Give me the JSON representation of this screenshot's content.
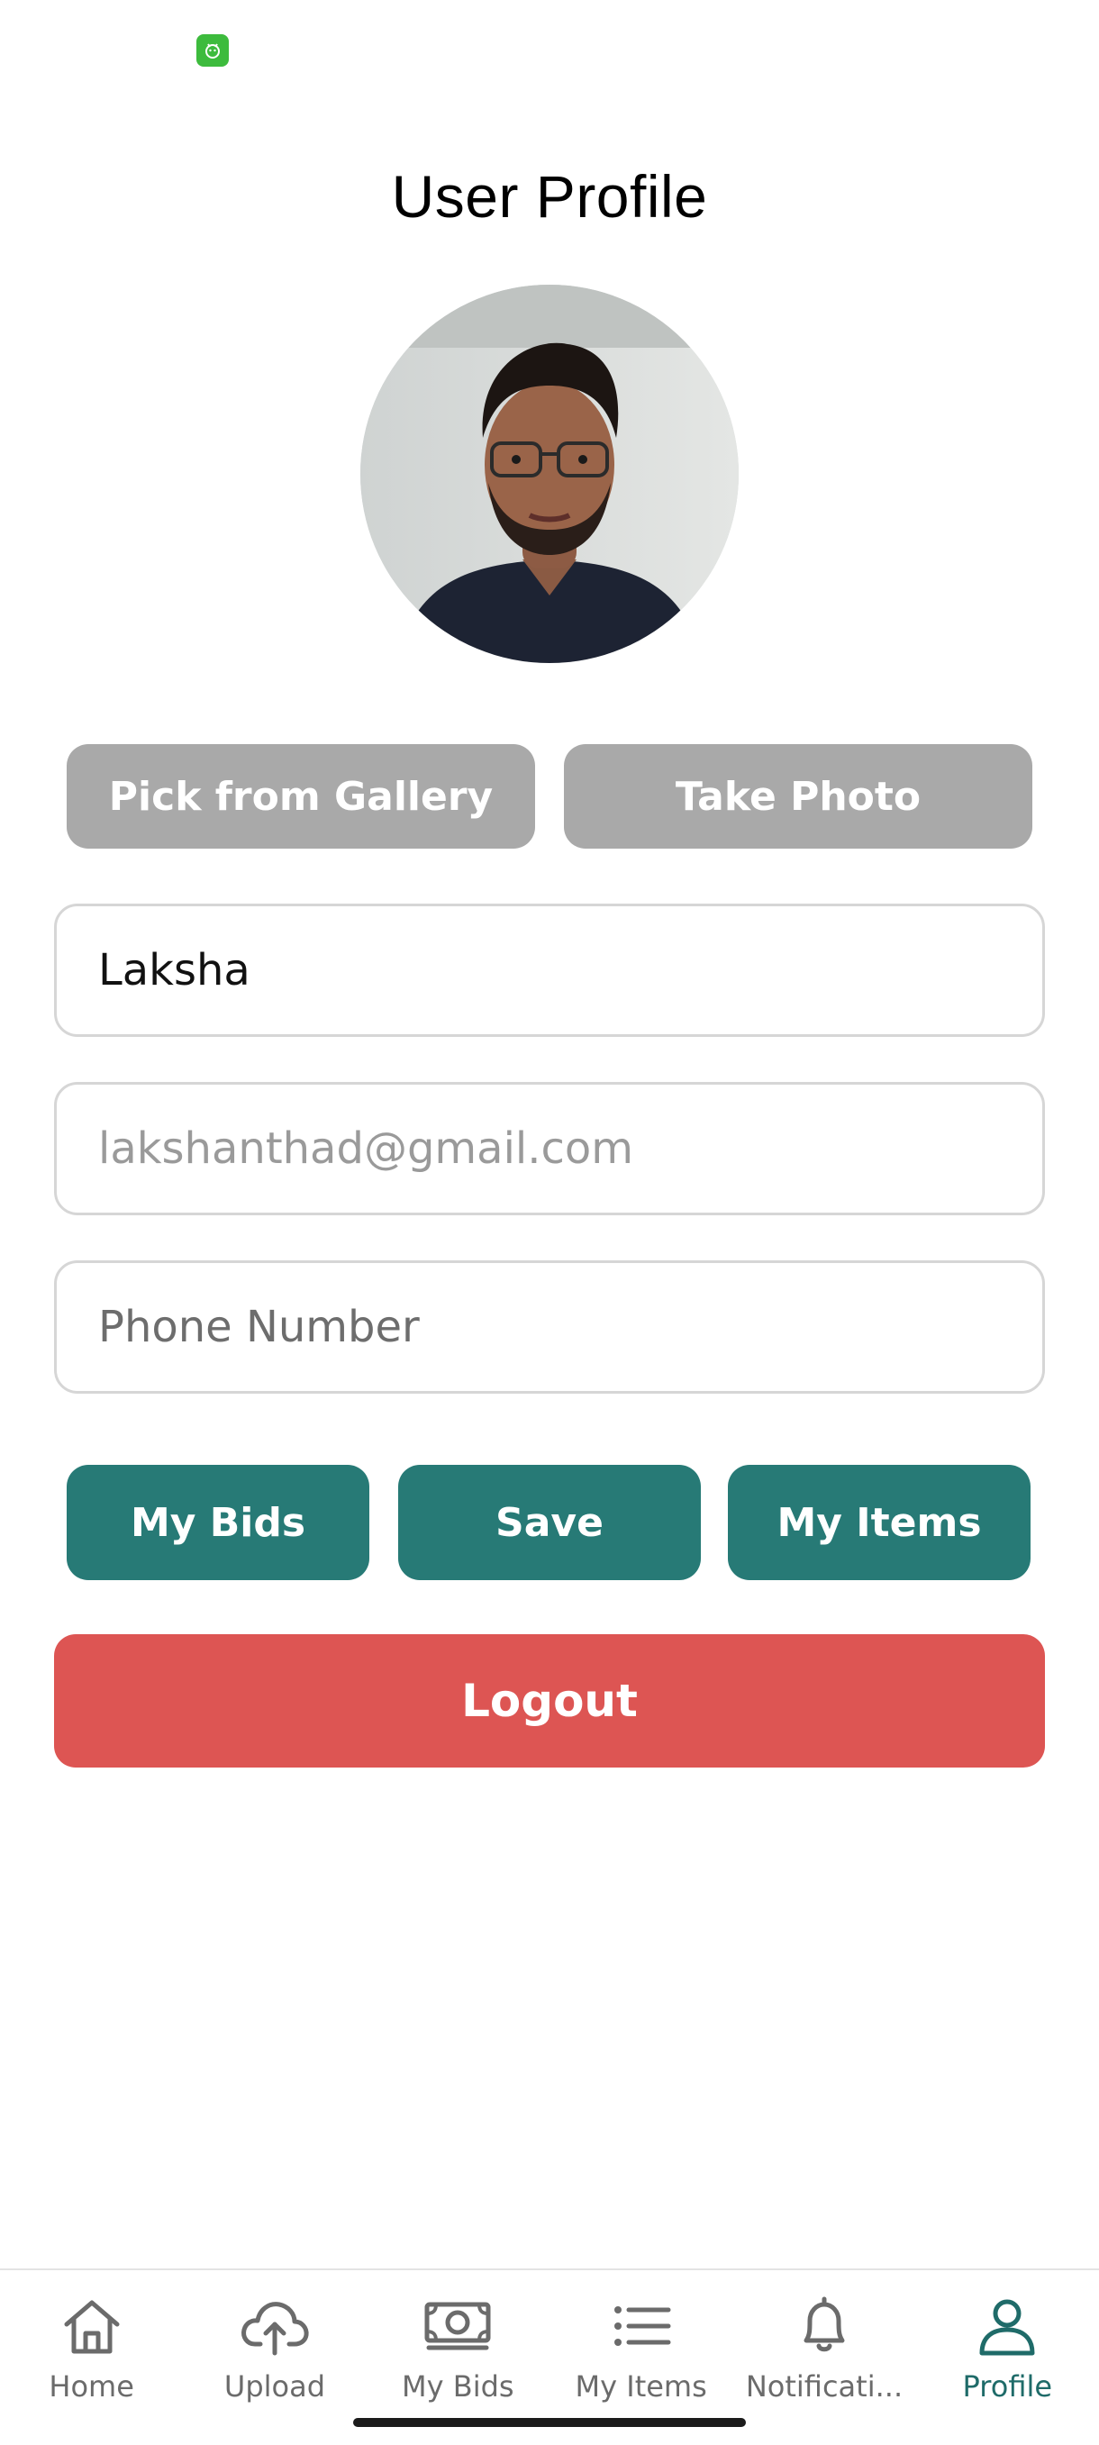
{
  "header": {
    "title": "User Profile"
  },
  "photo_actions": {
    "gallery_label": "Pick from Gallery",
    "camera_label": "Take Photo"
  },
  "form": {
    "name_value": "Laksha",
    "email_value": "lakshanthad@gmail.com",
    "phone_placeholder": "Phone Number"
  },
  "actions": {
    "my_bids_label": "My Bids",
    "save_label": "Save",
    "my_items_label": "My Items",
    "logout_label": "Logout"
  },
  "bottom_nav": {
    "items": [
      {
        "label": "Home",
        "icon": "home-icon"
      },
      {
        "label": "Upload",
        "icon": "cloud-upload-icon"
      },
      {
        "label": "My Bids",
        "icon": "money-icon"
      },
      {
        "label": "My Items",
        "icon": "list-icon"
      },
      {
        "label": "Notificati...",
        "icon": "bell-icon"
      },
      {
        "label": "Profile",
        "icon": "person-icon",
        "active": true
      }
    ]
  },
  "colors": {
    "primary_teal": "#277a76",
    "danger_red": "#dd5553",
    "disabled_grey": "#a9a9a9",
    "active_nav": "#1f6b69"
  }
}
